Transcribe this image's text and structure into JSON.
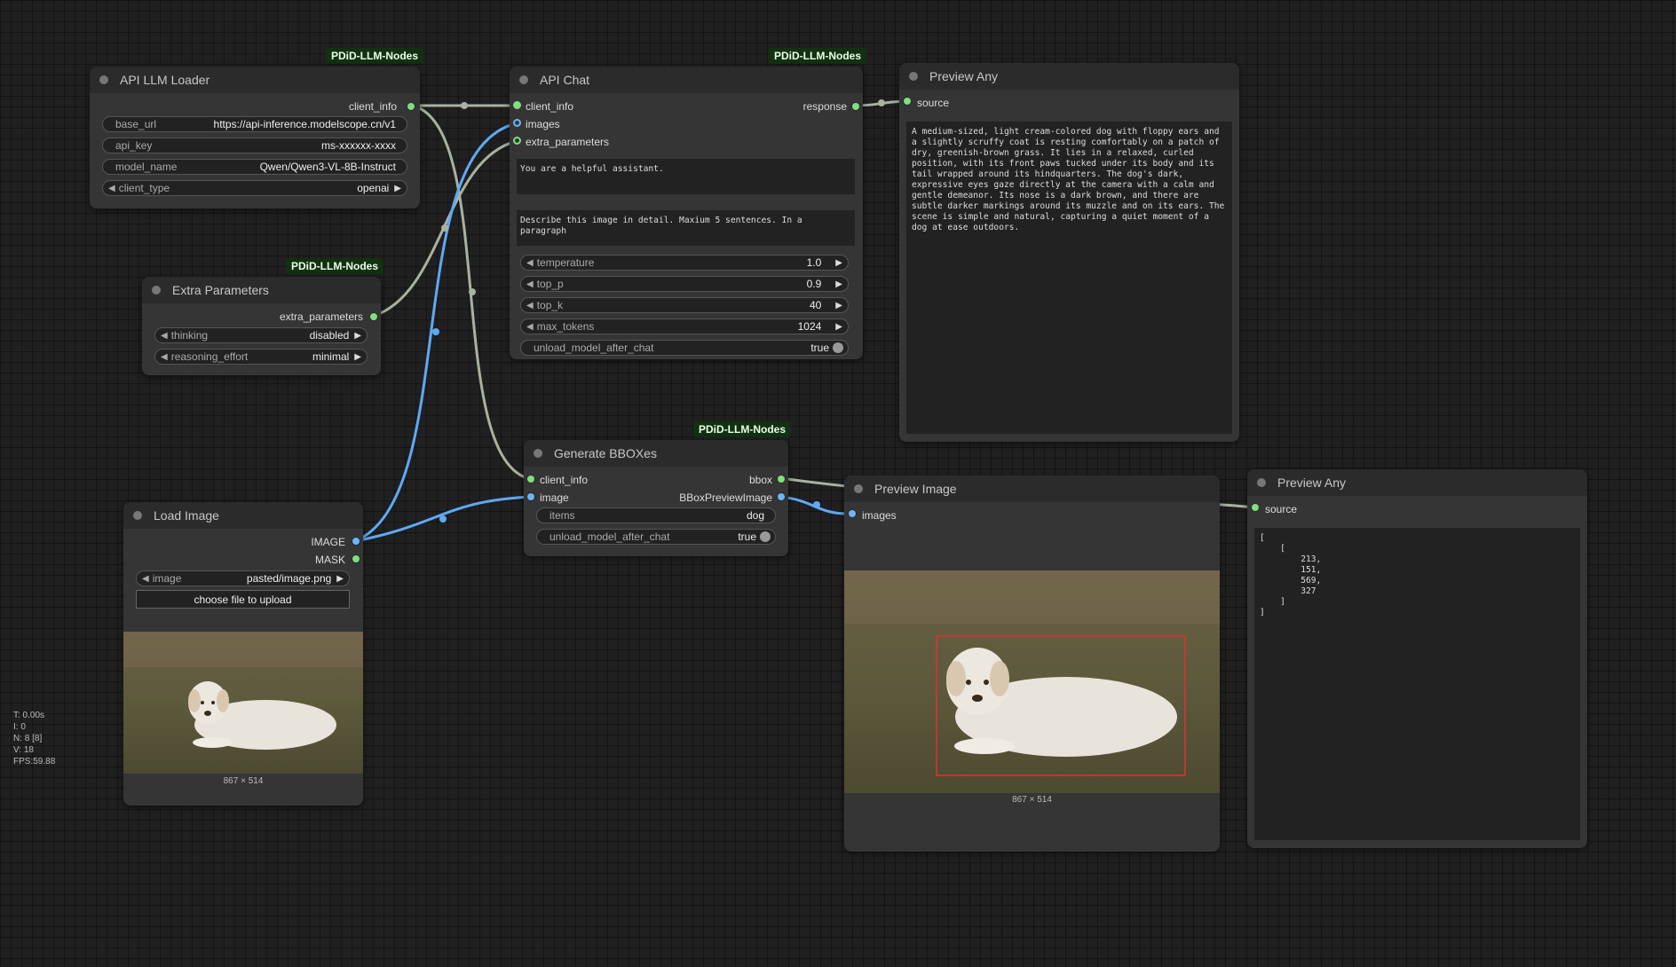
{
  "badge_text": "PDiD-LLM-Nodes",
  "nodes": {
    "api_llm_loader": {
      "title": "API LLM Loader",
      "output": "client_info",
      "base_url_label": "base_url",
      "base_url": "https://api-inference.modelscope.cn/v1",
      "api_key_label": "api_key",
      "api_key": "ms-xxxxxx-xxxx",
      "model_name_label": "model_name",
      "model_name": "Qwen/Qwen3-VL-8B-Instruct",
      "client_type_label": "client_type",
      "client_type": "openai"
    },
    "extra_parameters": {
      "title": "Extra Parameters",
      "output": "extra_parameters",
      "thinking_label": "thinking",
      "thinking": "disabled",
      "reasoning_label": "reasoning_effort",
      "reasoning": "minimal"
    },
    "api_chat": {
      "title": "API Chat",
      "inputs": [
        "client_info",
        "images",
        "extra_parameters"
      ],
      "output": "response",
      "system_prompt": "You are a helpful assistant.",
      "user_prompt": "Describe this image in detail. Maxium 5 sentences. In a paragraph",
      "temperature_label": "temperature",
      "temperature": "1.0",
      "top_p_label": "top_p",
      "top_p": "0.9",
      "top_k_label": "top_k",
      "top_k": "40",
      "max_tokens_label": "max_tokens",
      "max_tokens": "1024",
      "unload_label": "unload_model_after_chat",
      "unload": "true"
    },
    "preview_any_1": {
      "title": "Preview Any",
      "input": "source",
      "text": "A medium-sized, light cream-colored dog with floppy ears and a slightly scruffy coat is resting comfortably on a patch of dry, greenish-brown grass. It lies in a relaxed, curled position, with its front paws tucked under its body and its tail wrapped around its hindquarters. The dog's dark, expressive eyes gaze directly at the camera with a calm and gentle demeanor. Its nose is a dark brown, and there are subtle darker markings around its muzzle and on its ears. The scene is simple and natural, capturing a quiet moment of a dog at ease outdoors."
    },
    "generate_bboxes": {
      "title": "Generate BBOXes",
      "inputs": [
        "client_info",
        "image"
      ],
      "outputs": [
        "bbox",
        "BBoxPreviewImage"
      ],
      "items_label": "items",
      "items": "dog",
      "unload_label": "unload_model_after_chat",
      "unload": "true"
    },
    "load_image": {
      "title": "Load Image",
      "outputs": [
        "IMAGE",
        "MASK"
      ],
      "image_label": "image",
      "image": "pasted/image.png",
      "upload_label": "choose file to upload",
      "size": "867 × 514"
    },
    "preview_image": {
      "title": "Preview Image",
      "input": "images",
      "size": "867 × 514"
    },
    "preview_any_2": {
      "title": "Preview Any",
      "input": "source",
      "text": "[\n    [\n        213,\n        151,\n        569,\n        327\n    ]\n]"
    }
  },
  "stats": {
    "t": "T: 0.00s",
    "i": "I: 0",
    "n": "N: 8 [8]",
    "v": "V: 18",
    "fps": "FPS:59.88"
  }
}
